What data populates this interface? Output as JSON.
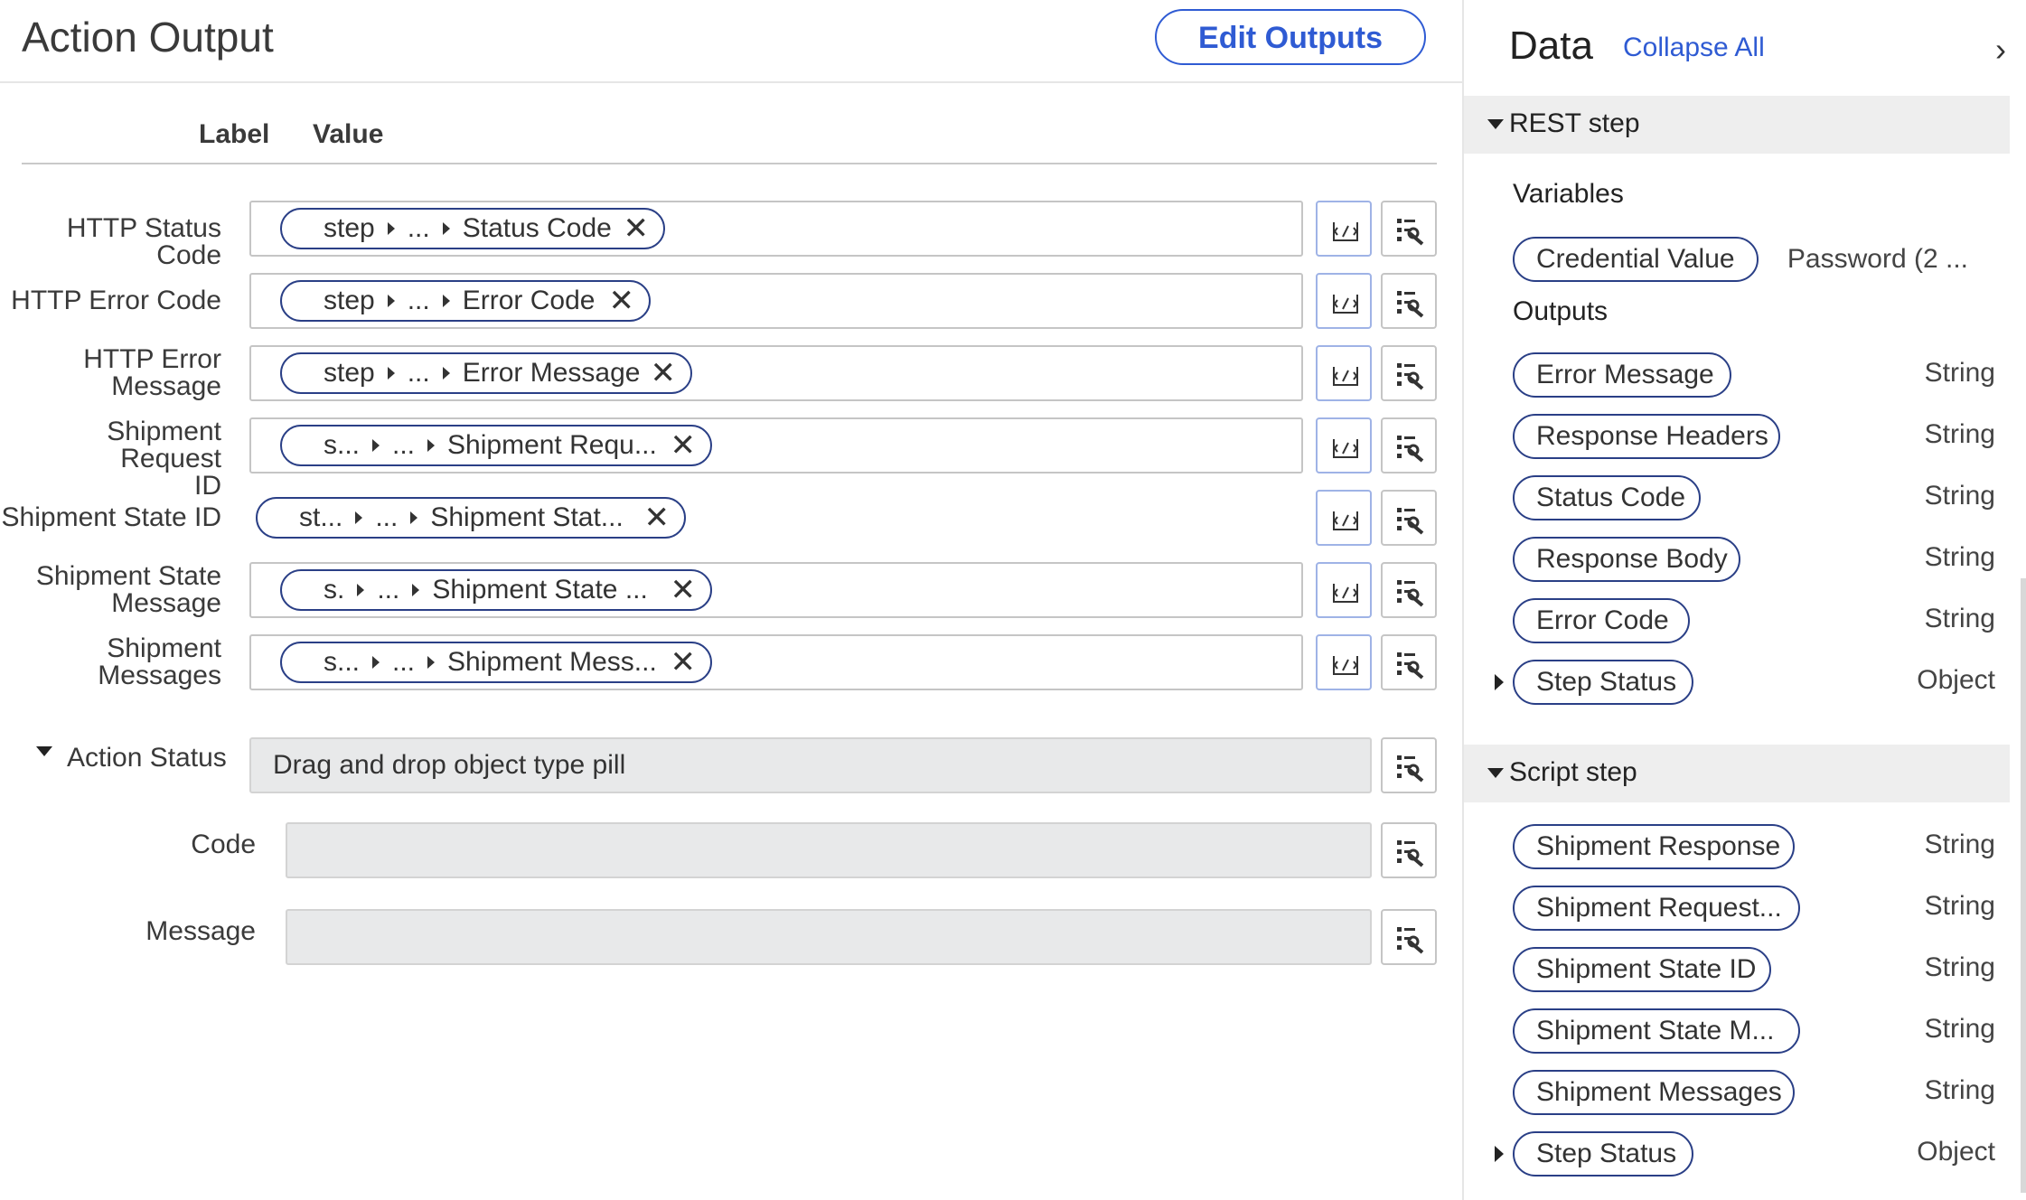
{
  "header": {
    "title": "Action Output",
    "edit_button": "Edit Outputs"
  },
  "columns": {
    "label": "Label",
    "value": "Value"
  },
  "rows": [
    {
      "label_lines": [
        "HTTP Status Code"
      ],
      "pill": [
        "step",
        "...",
        "Status Code"
      ]
    },
    {
      "label_lines": [
        "HTTP Error Code"
      ],
      "pill": [
        "step",
        "...",
        "Error Code"
      ]
    },
    {
      "label_lines": [
        "HTTP Error",
        "Message"
      ],
      "pill": [
        "step",
        "...",
        "Error Message"
      ]
    },
    {
      "label_lines": [
        "Shipment Request",
        "ID"
      ],
      "pill": [
        "s...",
        "...",
        "Shipment Requ..."
      ]
    },
    {
      "label_lines": [
        "Shipment State ID"
      ],
      "pill": [
        "st...",
        "...",
        "Shipment Stat..."
      ]
    },
    {
      "label_lines": [
        "Shipment State",
        "Message"
      ],
      "pill": [
        "s.",
        "...",
        "Shipment State ..."
      ]
    },
    {
      "label_lines": [
        "Shipment",
        "Messages"
      ],
      "pill": [
        "s...",
        "...",
        "Shipment Mess..."
      ]
    }
  ],
  "action_status": {
    "label": "Action Status",
    "placeholder": "Drag and drop object type pill",
    "code_label": "Code",
    "message_label": "Message"
  },
  "data_panel": {
    "title": "Data",
    "collapse_all": "Collapse All",
    "rest_step": {
      "title": "REST step",
      "variables_label": "Variables",
      "variables": [
        {
          "name": "Credential Value",
          "type": "Password (2 ..."
        }
      ],
      "outputs_label": "Outputs",
      "outputs": [
        {
          "name": "Error Message",
          "type": "String"
        },
        {
          "name": "Response Headers",
          "type": "String"
        },
        {
          "name": "Status Code",
          "type": "String"
        },
        {
          "name": "Response Body",
          "type": "String"
        },
        {
          "name": "Error Code",
          "type": "String"
        },
        {
          "name": "Step Status",
          "type": "Object"
        }
      ]
    },
    "script_step": {
      "title": "Script step",
      "outputs": [
        {
          "name": "Shipment Response",
          "type": "String"
        },
        {
          "name": "Shipment Request...",
          "type": "String"
        },
        {
          "name": "Shipment State ID",
          "type": "String"
        },
        {
          "name": "Shipment State M...",
          "type": "String"
        },
        {
          "name": "Shipment Messages",
          "type": "String"
        },
        {
          "name": "Step Status",
          "type": "Object"
        }
      ]
    }
  },
  "colors": {
    "accent": "#2f5bd3",
    "pill_border": "#2a3f86",
    "field_gray": "#e8e9ea"
  }
}
